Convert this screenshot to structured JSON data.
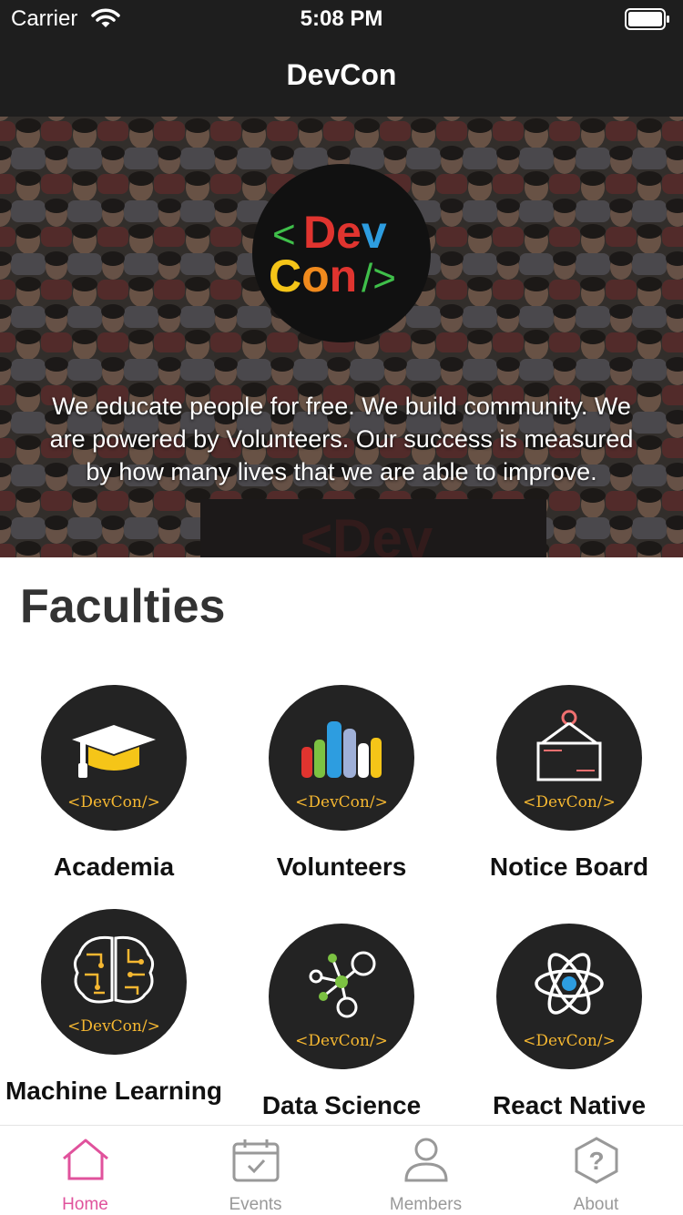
{
  "status_bar": {
    "carrier": "Carrier",
    "time": "5:08 PM"
  },
  "header": {
    "title": "DevCon"
  },
  "hero": {
    "logo_text_top": "<Dev",
    "logo_text_bottom": "Con/>",
    "tagline": "We educate people for free. We build community. We are powered by Volunteers. Our success is measured by how many lives that we are able to improve."
  },
  "faculties": {
    "title": "Faculties",
    "badge_text": "<DevCon/>",
    "items": [
      {
        "label": "Academia",
        "icon": "graduation-cap-icon"
      },
      {
        "label": "Volunteers",
        "icon": "raised-hands-icon"
      },
      {
        "label": "Notice Board",
        "icon": "notice-board-icon"
      },
      {
        "label": "Machine Learning",
        "icon": "brain-circuit-icon"
      },
      {
        "label": "Data Science",
        "icon": "network-nodes-icon"
      },
      {
        "label": "React Native",
        "icon": "react-atom-icon"
      }
    ]
  },
  "tabs": [
    {
      "label": "Home",
      "icon": "home-icon",
      "active": true
    },
    {
      "label": "Events",
      "icon": "calendar-icon",
      "active": false
    },
    {
      "label": "Members",
      "icon": "user-icon",
      "active": false
    },
    {
      "label": "About",
      "icon": "question-icon",
      "active": false
    }
  ],
  "colors": {
    "accent": "#e0529c",
    "header_bg": "#1e1e1e",
    "badge_text": "#f5b731",
    "circle_bg": "#232323"
  }
}
